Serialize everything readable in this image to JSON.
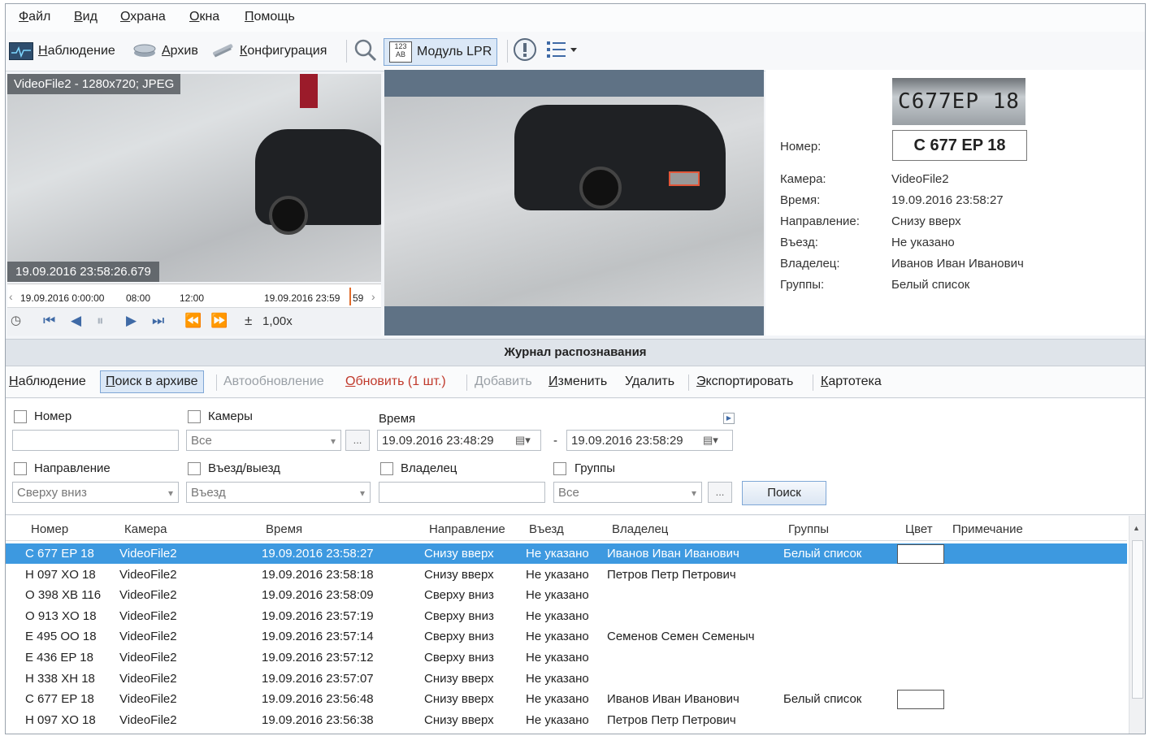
{
  "menu": [
    "Файл",
    "Вид",
    "Охрана",
    "Окна",
    "Помощь"
  ],
  "toolbar": {
    "monitoring": "Наблюдение",
    "archive": "Архив",
    "config": "Конфигурация",
    "lpr": "Модуль LPR",
    "lpr_icon": "123 AB"
  },
  "video1": {
    "label": "VideoFile2 - 1280x720; JPEG",
    "timestamp": "19.09.2016 23:58:26.679"
  },
  "timeline": {
    "t0": "19.09.2016 0:00:00",
    "t1": "08:00",
    "t2": "12:00",
    "t3": "19.09.2016 23:59",
    "t4": "59"
  },
  "playback": {
    "speed": "1,00x"
  },
  "info": {
    "plate_image_text": "C677EP 18",
    "plate": "C 677 EP 18",
    "number_label": "Номер:",
    "fields": [
      {
        "k": "Камера:",
        "v": "VideoFile2"
      },
      {
        "k": "Время:",
        "v": "19.09.2016 23:58:27"
      },
      {
        "k": "Направление:",
        "v": "Снизу вверх"
      },
      {
        "k": "Въезд:",
        "v": "Не указано"
      },
      {
        "k": "Владелец:",
        "v": "Иванов Иван Иванович"
      },
      {
        "k": "Группы:",
        "v": "Белый список"
      }
    ]
  },
  "journal": {
    "title": "Журнал распознавания",
    "toolbar": {
      "monitoring": "Наблюдение",
      "search": "Поиск в архиве",
      "autoupdate": "Автообновление",
      "refresh": "Обновить (1 шт.)",
      "add": "Добавить",
      "edit": "Изменить",
      "delete": "Удалить",
      "export": "Экспортировать",
      "card": "Картотека"
    }
  },
  "filters": {
    "number": "Номер",
    "cameras": "Камеры",
    "cameras_value": "Все",
    "time": "Время",
    "time_from": "19.09.2016 23:48:29",
    "time_dash": "-",
    "time_to": "19.09.2016 23:58:29",
    "direction": "Направление",
    "direction_value": "Сверху вниз",
    "entry": "Въезд/выезд",
    "entry_value": "Въезд",
    "owner": "Владелец",
    "groups": "Группы",
    "groups_value": "Все",
    "dots": "...",
    "search_button": "Поиск"
  },
  "table": {
    "headers": [
      "Номер",
      "Камера",
      "Время",
      "Направление",
      "Въезд",
      "Владелец",
      "Группы",
      "Цвет",
      "Примечание"
    ],
    "rows": [
      [
        "C 677 EP 18",
        "VideoFile2",
        "19.09.2016 23:58:27",
        "Снизу вверх",
        "Не указано",
        "Иванов Иван Иванович",
        "Белый список"
      ],
      [
        "H 097 XO 18",
        "VideoFile2",
        "19.09.2016 23:58:18",
        "Снизу вверх",
        "Не указано",
        "Петров Петр Петрович",
        ""
      ],
      [
        "O 398 XB 116",
        "VideoFile2",
        "19.09.2016 23:58:09",
        "Сверху вниз",
        "Не указано",
        "",
        ""
      ],
      [
        "O 913 XO 18",
        "VideoFile2",
        "19.09.2016 23:57:19",
        "Сверху вниз",
        "Не указано",
        "",
        ""
      ],
      [
        "E 495 OO 18",
        "VideoFile2",
        "19.09.2016 23:57:14",
        "Сверху вниз",
        "Не указано",
        "Семенов Семен Семеныч",
        ""
      ],
      [
        "E 436 EP 18",
        "VideoFile2",
        "19.09.2016 23:57:12",
        "Сверху вниз",
        "Не указано",
        "",
        ""
      ],
      [
        "H 338 XH 18",
        "VideoFile2",
        "19.09.2016 23:57:07",
        "Снизу вверх",
        "Не указано",
        "",
        ""
      ],
      [
        "C 677 EP 18",
        "VideoFile2",
        "19.09.2016 23:56:48",
        "Снизу вверх",
        "Не указано",
        "Иванов Иван Иванович",
        "Белый список"
      ],
      [
        "H 097 XO 18",
        "VideoFile2",
        "19.09.2016 23:56:38",
        "Снизу вверх",
        "Не указано",
        "Петров Петр Петрович",
        ""
      ]
    ]
  },
  "colors": {
    "accent": "#3d99e0",
    "panel": "#5f7285",
    "refresh": "#c0392b"
  }
}
